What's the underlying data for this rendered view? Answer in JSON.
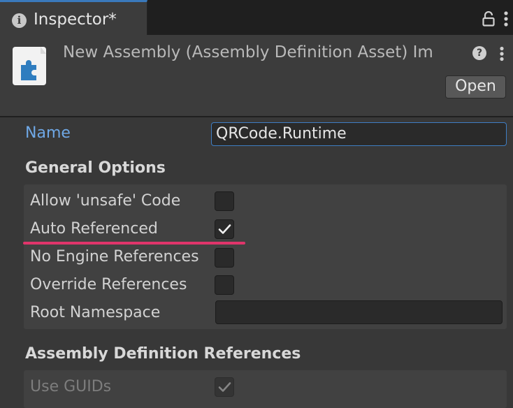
{
  "tab": {
    "title": "Inspector*",
    "info_icon": "info-icon",
    "lock_icon": "lock-icon",
    "menu_icon": "kebab-menu-icon"
  },
  "header": {
    "title": "New Assembly (Assembly Definition Asset) Im",
    "asset_icon": "puzzle-piece-icon",
    "help_icon": "help-icon",
    "help_glyph": "?",
    "menu_icon": "kebab-menu-icon",
    "open_label": "Open"
  },
  "name_field": {
    "label": "Name",
    "value": "QRCode.Runtime"
  },
  "general_options": {
    "title": "General Options",
    "rows": [
      {
        "label": "Allow 'unsafe' Code",
        "checked": false
      },
      {
        "label": "Auto Referenced",
        "checked": true
      },
      {
        "label": "No Engine References",
        "checked": false
      },
      {
        "label": "Override References",
        "checked": false
      }
    ],
    "root_namespace": {
      "label": "Root Namespace",
      "value": ""
    }
  },
  "assembly_refs": {
    "title": "Assembly Definition References",
    "use_guids": {
      "label": "Use GUIDs",
      "checked": true,
      "disabled": true
    }
  },
  "colors": {
    "accent": "#3a79bb",
    "name_label": "#6fa8e6",
    "annotation": "#e0356b",
    "background": "#383838"
  }
}
